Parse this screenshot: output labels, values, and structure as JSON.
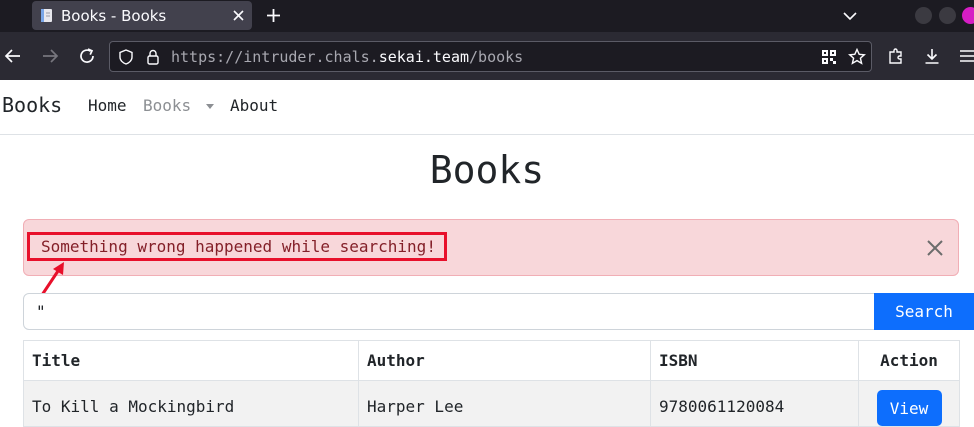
{
  "browser": {
    "tab_title": "Books - Books",
    "url_prefix": "https://intruder.chals.",
    "url_domain": "sekai.team",
    "url_path": "/books"
  },
  "site": {
    "brand": "Books",
    "nav": {
      "home": "Home",
      "books": "Books",
      "about": "About"
    },
    "page_title": "Books"
  },
  "alert": {
    "message": "Something wrong happened while searching!"
  },
  "search": {
    "value": "\"",
    "button": "Search"
  },
  "table": {
    "headers": [
      "Title",
      "Author",
      "ISBN",
      "Action"
    ],
    "rows": [
      {
        "title": "To Kill a Mockingbird",
        "author": "Harper Lee",
        "isbn": "9780061120084",
        "action": "View"
      }
    ]
  },
  "colors": {
    "alert_bg": "#f8d7da",
    "annotation": "#e8102b",
    "primary": "#0d6efd"
  }
}
